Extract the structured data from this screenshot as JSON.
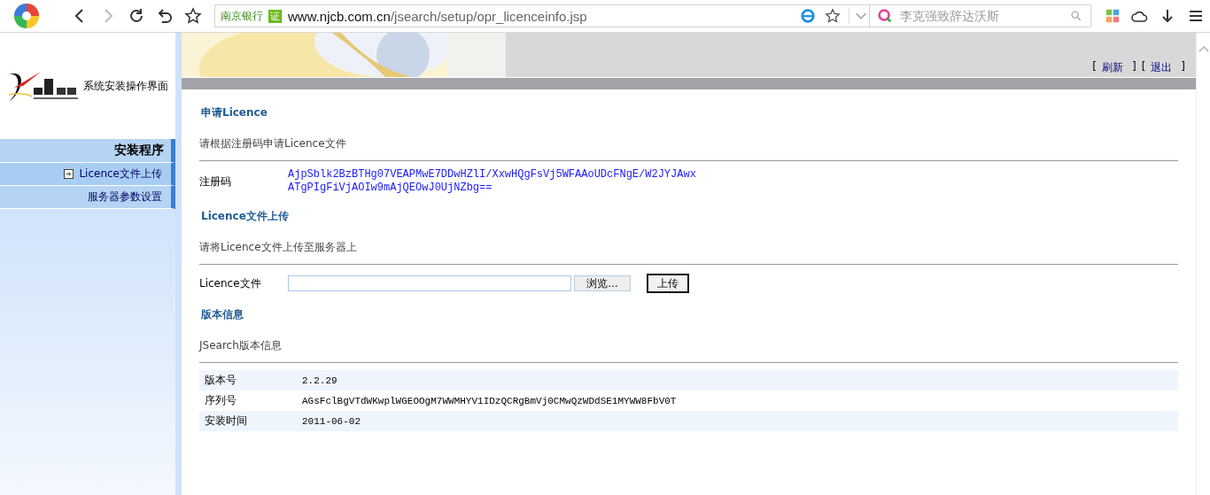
{
  "browser": {
    "bank_label": "南京银行",
    "cert_badge": "证",
    "url_host": "www.njcb.com.cn",
    "url_path": "/jsearch/setup/opr_licenceinfo.jsp",
    "search_placeholder": "李克强致辞达沃斯"
  },
  "header": {
    "brackets": [
      "[",
      "]"
    ],
    "links": [
      {
        "label": "刷新"
      },
      {
        "label": "退出"
      }
    ]
  },
  "sidebar": {
    "title": "系统安装操作界面",
    "menu_title": "安装程序",
    "items": [
      {
        "label": "Licence文件上传",
        "selected": true
      },
      {
        "label": "服务器参数设置",
        "selected": false
      }
    ]
  },
  "sections": [
    {
      "kind": "code",
      "title": "申请Licence",
      "description": "请根据注册码申请Licence文件",
      "label": "注册码",
      "lines": [
        "AjpSblk2BzBTHg07VEAPMwE7DDwHZlI/XxwHQgFsVj5WFAAoUDcFNgE/W2JYJAwx",
        "ATgPIgFiVjAOIw9mAjQEOwJ0UjNZbg=="
      ]
    },
    {
      "kind": "upload",
      "title": "Licence文件上传",
      "description": "请将Licence文件上传至服务器上",
      "label": "Licence文件",
      "browse": "浏览...",
      "upload": "上传"
    },
    {
      "kind": "table",
      "title": "版本信息",
      "description": "JSearch版本信息",
      "rows": [
        {
          "label": "版本号",
          "value": "2.2.29"
        },
        {
          "label": "序列号",
          "value": "AGsFclBgVTdWKwplWGEOOgM7WWMHYV1IDzQCRgBmVj0CMwQzWDdSE1MYWW8FbV0T"
        },
        {
          "label": "安装时间",
          "value": "2011-06-02"
        }
      ]
    }
  ]
}
